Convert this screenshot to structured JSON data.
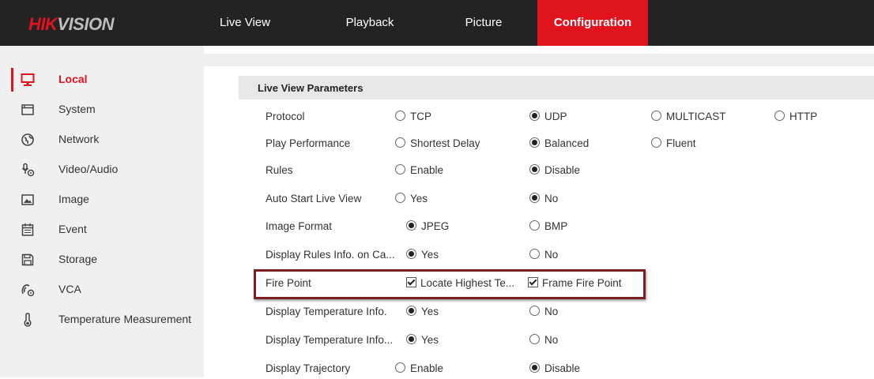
{
  "brand": {
    "logo_red": "HIK",
    "logo_gray": "VISION"
  },
  "nav": {
    "items": [
      {
        "label": "Live View"
      },
      {
        "label": "Playback"
      },
      {
        "label": "Picture"
      },
      {
        "label": "Configuration",
        "active": true
      }
    ]
  },
  "sidebar": {
    "items": [
      {
        "label": "Local",
        "icon": "monitor-icon",
        "active": true
      },
      {
        "label": "System",
        "icon": "window-icon"
      },
      {
        "label": "Network",
        "icon": "globe-icon"
      },
      {
        "label": "Video/Audio",
        "icon": "microphone-icon"
      },
      {
        "label": "Image",
        "icon": "image-icon"
      },
      {
        "label": "Event",
        "icon": "calendar-icon"
      },
      {
        "label": "Storage",
        "icon": "floppy-disk-icon"
      },
      {
        "label": "VCA",
        "icon": "vca-icon"
      },
      {
        "label": "Temperature Measurement",
        "icon": "thermometer-icon"
      }
    ]
  },
  "section": {
    "title": "Live View Parameters"
  },
  "params": [
    {
      "label": "Protocol",
      "type": "radio",
      "options": [
        {
          "text": "TCP",
          "checked": false
        },
        {
          "text": "UDP",
          "checked": true
        },
        {
          "text": "MULTICAST",
          "checked": false
        },
        {
          "text": "HTTP",
          "checked": false
        }
      ]
    },
    {
      "label": "Play Performance",
      "type": "radio",
      "options": [
        {
          "text": "Shortest Delay",
          "checked": false
        },
        {
          "text": "Balanced",
          "checked": true
        },
        {
          "text": "Fluent",
          "checked": false
        }
      ]
    },
    {
      "label": "Rules",
      "type": "radio",
      "options": [
        {
          "text": "Enable",
          "checked": false
        },
        {
          "text": "Disable",
          "checked": true
        }
      ]
    },
    {
      "label": "Auto Start Live View",
      "type": "radio",
      "options": [
        {
          "text": "Yes",
          "checked": false
        },
        {
          "text": "No",
          "checked": true
        }
      ]
    },
    {
      "label": "Image Format",
      "type": "radio",
      "options": [
        {
          "text": "JPEG",
          "checked": true
        },
        {
          "text": "BMP",
          "checked": false
        }
      ]
    },
    {
      "label": "Display Rules Info. on Ca...",
      "type": "radio",
      "options": [
        {
          "text": "Yes",
          "checked": true
        },
        {
          "text": "No",
          "checked": false
        }
      ]
    },
    {
      "label": "Fire Point",
      "type": "checkbox",
      "options": [
        {
          "text": "Locate Highest Te...",
          "checked": true
        },
        {
          "text": "Frame Fire Point",
          "checked": true
        }
      ]
    },
    {
      "label": "Display Temperature Info.",
      "type": "radio",
      "options": [
        {
          "text": "Yes",
          "checked": true
        },
        {
          "text": "No",
          "checked": false
        }
      ]
    },
    {
      "label": "Display Temperature Info...",
      "type": "radio",
      "options": [
        {
          "text": "Yes",
          "checked": true
        },
        {
          "text": "No",
          "checked": false
        }
      ]
    },
    {
      "label": "Display Trajectory",
      "type": "radio",
      "options": [
        {
          "text": "Enable",
          "checked": false
        },
        {
          "text": "Disable",
          "checked": true
        }
      ]
    }
  ],
  "colors": {
    "accent": "#e1141e",
    "topbar": "#232323",
    "sidebar": "#f0f0f0",
    "highlight": "#7a1f24"
  }
}
